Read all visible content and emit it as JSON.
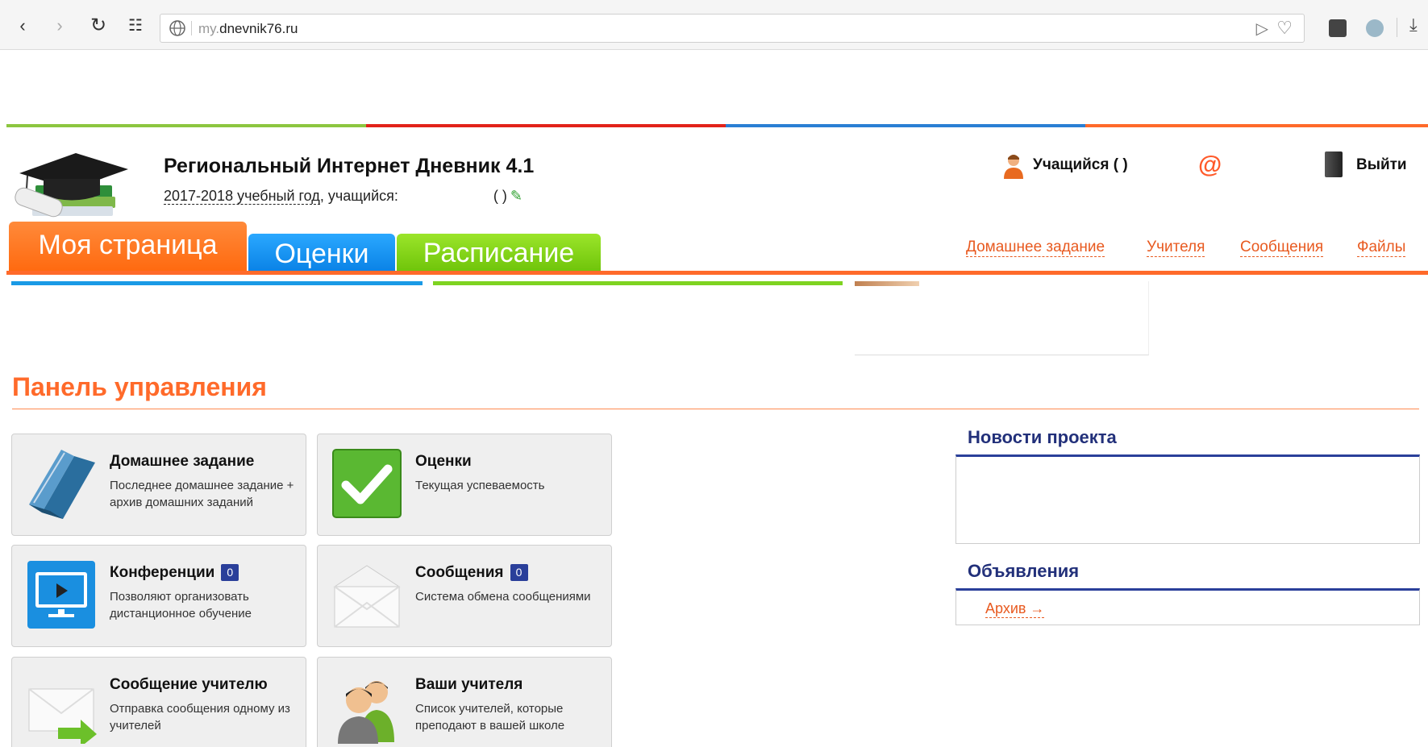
{
  "browser": {
    "url_prefix": "my.",
    "url_domain": "dnevnik76.ru"
  },
  "colors": {
    "stripe": [
      "#8cc63f",
      "#e2231a",
      "#2a7fd4",
      "#ff6a2a"
    ],
    "accent": "#ff6a2a",
    "link": "#e85a20",
    "badge": "#2a3f9a"
  },
  "header": {
    "title": "Региональный Интернет Дневник 4.1",
    "year_link": "2017-2018 учебный год",
    "year_suffix": ", учащийся:",
    "paren": "(     )",
    "user_label": "Учащийся (        )",
    "logout": "Выйти"
  },
  "tabs": {
    "my_page": "Моя страница",
    "grades": "Оценки",
    "schedule": "Расписание"
  },
  "top_links": [
    "Домашнее задание",
    "Учителя",
    "Сообщения",
    "Файлы"
  ],
  "panel": {
    "title": "Панель управления",
    "cards": [
      {
        "title": "Домашнее задание",
        "desc": "Последнее домашнее задание + архив домашних заданий",
        "icon": "book-icon"
      },
      {
        "title": "Оценки",
        "desc": "Текущая успеваемость",
        "icon": "checkmark-icon"
      },
      {
        "title": "Конференции",
        "badge": "0",
        "desc": "Позволяют организовать дистанционное обучение",
        "icon": "monitor-icon"
      },
      {
        "title": "Сообщения",
        "badge": "0",
        "desc": "Система обмена сообщениями",
        "icon": "envelope-icon"
      },
      {
        "title": "Сообщение учителю",
        "desc": "Отправка сообщения одному из учителей",
        "icon": "send-envelope-icon"
      },
      {
        "title": "Ваши учителя",
        "desc": "Список учителей, которые преподают в вашей школе",
        "icon": "teachers-icon"
      }
    ]
  },
  "sidebar": {
    "news_title": "Новости проекта",
    "announcements_title": "Объявления",
    "archive_link": "Архив →"
  }
}
